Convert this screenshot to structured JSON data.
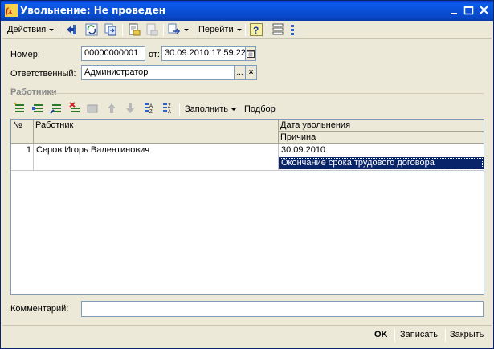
{
  "window": {
    "title": "Увольнение: Не проведен",
    "colors": {
      "titlebar": "#0a4fd6",
      "background": "#ece9d8",
      "selection": "#0a246a"
    }
  },
  "toolbar": {
    "actions_label": "Действия",
    "goto_label": "Перейти",
    "help_icon": "question-icon"
  },
  "header": {
    "number_label": "Номер:",
    "number_value": "00000000001",
    "date_label": "от:",
    "date_value": "30.09.2010 17:59:22",
    "responsible_label": "Ответственный:",
    "responsible_value": "Администратор",
    "select_btn": "...",
    "clear_btn": "×"
  },
  "employees": {
    "section_title": "Работники",
    "fill_label": "Заполнить",
    "pick_label": "Подбор",
    "columns": {
      "num": "№",
      "employee": "Работник",
      "date": "Дата увольнения",
      "reason": "Причина"
    },
    "rows": [
      {
        "num": "1",
        "employee": "Серов Игорь Валентинович",
        "date": "30.09.2010",
        "reason": "Окончание срока трудового договора"
      }
    ]
  },
  "comment": {
    "label": "Комментарий:",
    "value": ""
  },
  "footer": {
    "ok_label": "OK",
    "save_label": "Записать",
    "close_label": "Закрыть"
  }
}
